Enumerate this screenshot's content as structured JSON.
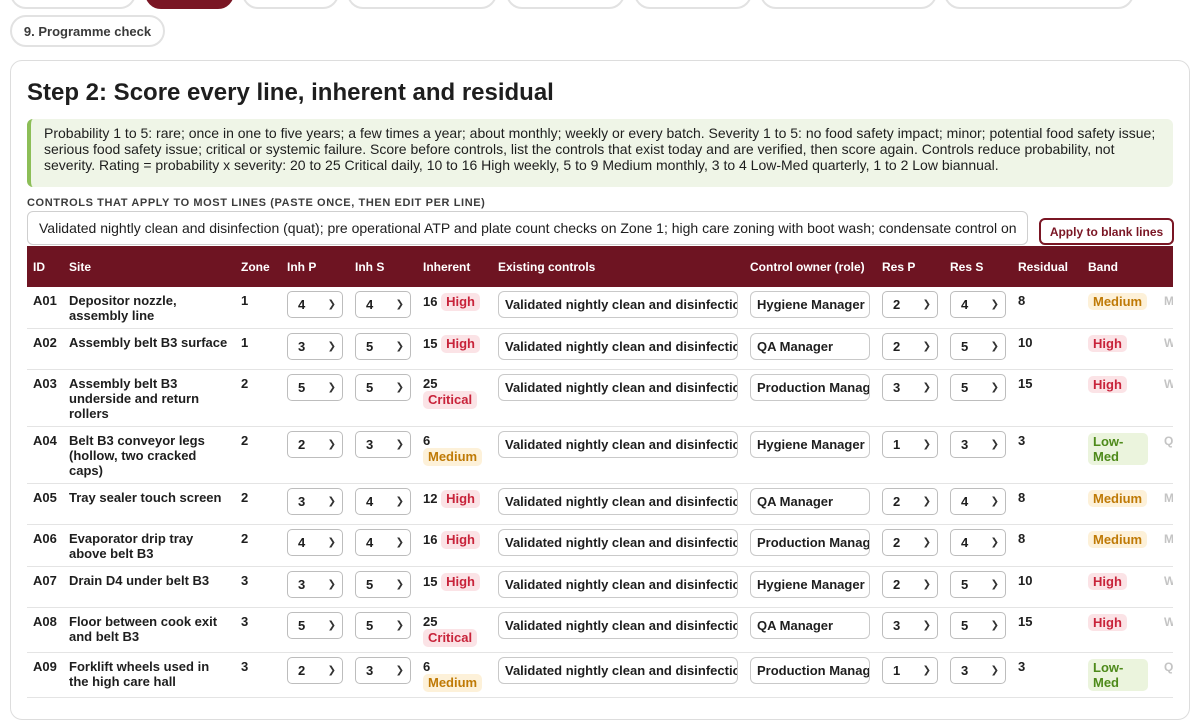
{
  "tabs": {
    "programme_check": "9. Programme check"
  },
  "title": "Step 2: Score every line, inherent and residual",
  "info": "Probability 1 to 5: rare; once in one to five years; a few times a year; about monthly; weekly or every batch. Severity 1 to 5: no food safety impact; minor; potential food safety issue; serious food safety issue; critical or systemic failure. Score before controls, list the controls that exist today and are verified, then score again. Controls reduce probability, not severity. Rating = probability x severity: 20 to 25 Critical daily, 10 to 16 High weekly, 5 to 9 Medium monthly, 3 to 4 Low-Med quarterly, 1 to 2 Low biannual.",
  "controls_section": {
    "label": "CONTROLS THAT APPLY TO MOST LINES (PASTE ONCE, THEN EDIT PER LINE)",
    "value": "Validated nightly clean and disinfection (quat); pre operational ATP and plate count checks on Zone 1; high care zoning with boot wash; condensate control on",
    "apply_button": "Apply to blank lines"
  },
  "table": {
    "headers": {
      "id": "ID",
      "site": "Site",
      "zone": "Zone",
      "inh_p": "Inh P",
      "inh_s": "Inh S",
      "inherent": "Inherent",
      "controls": "Existing controls",
      "owner": "Control owner (role)",
      "res_p": "Res P",
      "res_s": "Res S",
      "residual": "Residual",
      "band": "Band"
    },
    "rows": [
      {
        "id": "A01",
        "site": "Depositor nozzle, assembly line",
        "zone": "1",
        "inh_p": "4",
        "inh_s": "4",
        "inherent": "16",
        "inherent_band": "High",
        "controls": "Validated nightly clean and disinfection",
        "owner": "Hygiene Manager",
        "res_p": "2",
        "res_s": "4",
        "residual": "8",
        "band": "Medium",
        "freq": "M"
      },
      {
        "id": "A02",
        "site": "Assembly belt B3 surface",
        "zone": "1",
        "inh_p": "3",
        "inh_s": "5",
        "inherent": "15",
        "inherent_band": "High",
        "controls": "Validated nightly clean and disinfection",
        "owner": "QA Manager",
        "res_p": "2",
        "res_s": "5",
        "residual": "10",
        "band": "High",
        "freq": "W"
      },
      {
        "id": "A03",
        "site": "Assembly belt B3 underside and return rollers",
        "zone": "2",
        "inh_p": "5",
        "inh_s": "5",
        "inherent": "25",
        "inherent_band": "Critical",
        "controls": "Validated nightly clean and disinfection",
        "owner": "Production Manag",
        "res_p": "3",
        "res_s": "5",
        "residual": "15",
        "band": "High",
        "freq": "W"
      },
      {
        "id": "A04",
        "site": "Belt B3 conveyor legs (hollow, two cracked caps)",
        "zone": "2",
        "inh_p": "2",
        "inh_s": "3",
        "inherent": "6",
        "inherent_band": "Medium",
        "controls": "Validated nightly clean and disinfection",
        "owner": "Hygiene Manager",
        "res_p": "1",
        "res_s": "3",
        "residual": "3",
        "band": "Low-Med",
        "freq": "Q"
      },
      {
        "id": "A05",
        "site": "Tray sealer touch screen",
        "zone": "2",
        "inh_p": "3",
        "inh_s": "4",
        "inherent": "12",
        "inherent_band": "High",
        "controls": "Validated nightly clean and disinfection",
        "owner": "QA Manager",
        "res_p": "2",
        "res_s": "4",
        "residual": "8",
        "band": "Medium",
        "freq": "M"
      },
      {
        "id": "A06",
        "site": "Evaporator drip tray above belt B3",
        "zone": "2",
        "inh_p": "4",
        "inh_s": "4",
        "inherent": "16",
        "inherent_band": "High",
        "controls": "Validated nightly clean and disinfection",
        "owner": "Production Manag",
        "res_p": "2",
        "res_s": "4",
        "residual": "8",
        "band": "Medium",
        "freq": "M"
      },
      {
        "id": "A07",
        "site": "Drain D4 under belt B3",
        "zone": "3",
        "inh_p": "3",
        "inh_s": "5",
        "inherent": "15",
        "inherent_band": "High",
        "controls": "Validated nightly clean and disinfection",
        "owner": "Hygiene Manager",
        "res_p": "2",
        "res_s": "5",
        "residual": "10",
        "band": "High",
        "freq": "W"
      },
      {
        "id": "A08",
        "site": "Floor between cook exit and belt B3",
        "zone": "3",
        "inh_p": "5",
        "inh_s": "5",
        "inherent": "25",
        "inherent_band": "Critical",
        "controls": "Validated nightly clean and disinfection",
        "owner": "QA Manager",
        "res_p": "3",
        "res_s": "5",
        "residual": "15",
        "band": "High",
        "freq": "W"
      },
      {
        "id": "A09",
        "site": "Forklift wheels used in the high care hall",
        "zone": "3",
        "inh_p": "2",
        "inh_s": "3",
        "inherent": "6",
        "inherent_band": "Medium",
        "controls": "Validated nightly clean and disinfection",
        "owner": "Production Manag",
        "res_p": "1",
        "res_s": "3",
        "residual": "3",
        "band": "Low-Med",
        "freq": "Q"
      }
    ]
  },
  "colors": {
    "accent": "#7a1624",
    "header_bg": "#6e1422",
    "high": "#c8233a",
    "medium": "#bf7a06",
    "low_med": "#4e8a1a",
    "info_bg": "#eff5e7",
    "info_border": "#8cbe57"
  }
}
